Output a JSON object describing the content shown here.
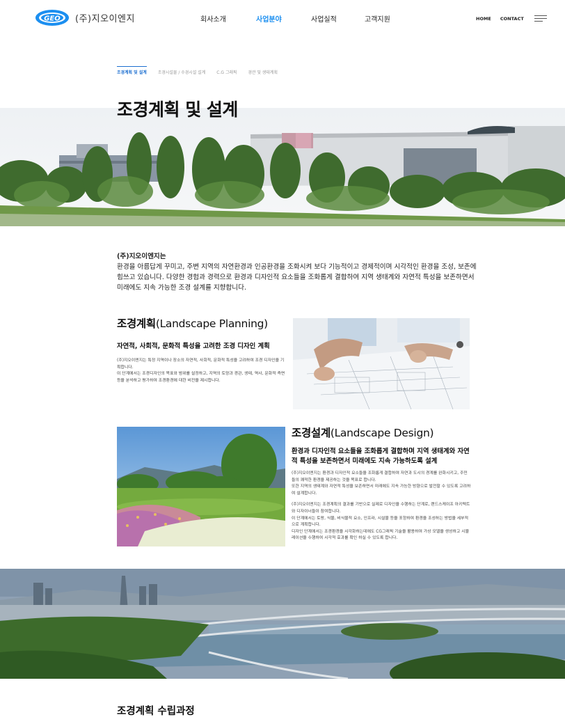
{
  "header": {
    "logo_mark": "GEO",
    "company": "(주)지오이엔지",
    "nav": [
      "회사소개",
      "사업분야",
      "사업실적",
      "고객지원"
    ],
    "util": [
      "HOME",
      "CONTACT"
    ],
    "menu_icon": "hamburger-menu-icon",
    "accent_color": "#1c8ff0"
  },
  "subtabs": [
    "조경계획 및 설계",
    "조경시설물 / 수경시설 설계",
    "C.G 그래픽",
    "경관 및 생태계획"
  ],
  "page_title": "조경계획 및 설계",
  "intro": {
    "lead": "(주)지오이엔지는",
    "text": "환경을 아름답게 꾸미고, 주변 지역의 자연환경과 인공환경을 조화시켜 보다 기능적이고 경제적이며 시각적인 환경을 조성, 보존에 힘쓰고 있습니다. 다양한 경험과 경력으로 환경과 디자인적 요소들을 조화롭게 결합하여 지역 생태계와 자연적 특성을 보존하면서 미래에도 지속 가능한 조경 설계를 지향합니다."
  },
  "planning": {
    "title_ko": "조경계획",
    "title_en": "(Landscape Planning)",
    "subtitle": "자연적, 사회적, 문화적 특성을 고려한 조경 디자인 계획",
    "body": "(주)지오이엔지는 특정 지역이나 장소의 자연적, 사회적, 문화적 특성을 고려하여 조경 디자인을 기획합니다.\n이 단계에서는 조경디자인의 목표와 범위를 설정하고, 지역의 토양과 경관, 생태, 역사, 문화적 측면 등을 분석하고 평가하여 조경환경에 대한 비전을 제시합니다."
  },
  "design": {
    "title_ko": "조경설계",
    "title_en": "(Landscape Design)",
    "subtitle": "환경과 디자인적 요소들을 조화롭게 결합하며 지역 생태계와 자연적 특성을 보존하면서 미래에도 지속 가능하도록 설계",
    "body1": "(주)지오이엔지는 환경과 디자인적 요소들을 조화롭게 결합하여 자연과 도시의 경계를 완화시키고, 주민들의 쾌적한 환경을 제공하는 것을 목표로 합니다.\n또한 지역의 생태계와 자연적 특성을 보존하면서 미래에도 지속 가능한 방향으로 발전할 수 있도록 고려하여 설계합니다.",
    "body2": "(주)지오이엔지는 조경계획의 결과를 기반으로 실제로 디자인을 수행하는 단계로, 랜드스케이프 아키텍트와 디자이너들이 참여합니다.\n이 단계에서는 토랑, 식물, 비식물적 요소, 인프라, 시설물 등을 포함하여 환경을 조성하는 방법을 세부적으로 계획합니다.\n디자인 단계에서는 조경환경을 시각화하는데에도 CG그래픽 기술을 활용하여 가상 모델을 생성하고 시뮬레이션을 수행하여 시각적 효과를 확인 하실 수 있도록 합니다."
  },
  "bottom_title": "조경계획 수립과정"
}
